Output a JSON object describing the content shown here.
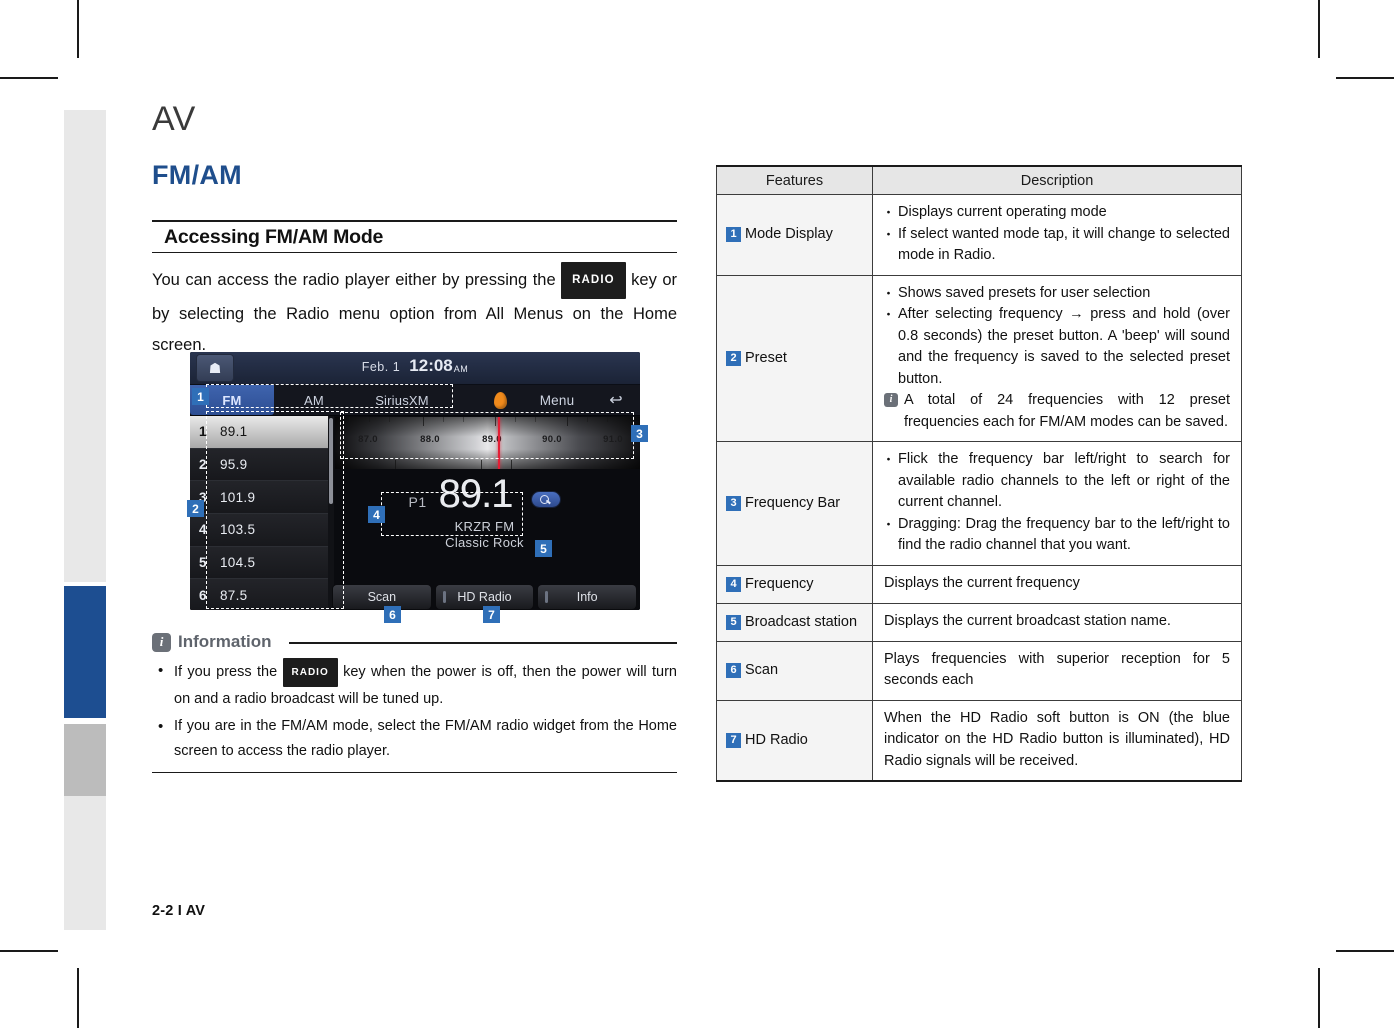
{
  "chapter": "AV",
  "section": "FM/AM",
  "subhead": "Accessing FM/AM Mode",
  "body_part1": "You can access the radio player either by pressing the ",
  "radio_key": "RADIO",
  "body_part2": " key or by selecting the Radio menu option from All Menus on the Home screen.",
  "device": {
    "status": {
      "date": "Feb.  1",
      "time": "12:08",
      "ampm": "AM",
      "home_icon": "home-icon"
    },
    "tabs": {
      "fm": "FM",
      "am": "AM",
      "siriusxm": "SiriusXM",
      "menu": "Menu",
      "back": "↩",
      "sound_icon": "sound-icon"
    },
    "presets": [
      {
        "num": "1",
        "freq": "89.1"
      },
      {
        "num": "2",
        "freq": "95.9"
      },
      {
        "num": "3",
        "freq": "101.9"
      },
      {
        "num": "4",
        "freq": "103.5"
      },
      {
        "num": "5",
        "freq": "104.5"
      },
      {
        "num": "6",
        "freq": "87.5"
      }
    ],
    "freq_bar": {
      "ticks": [
        "87.0",
        "88.0",
        "89.0",
        "90.0",
        "91.0"
      ],
      "needle_at": "89.1"
    },
    "now_playing": {
      "preset_label": "P1",
      "frequency": "89.1",
      "station": "KRZR FM",
      "genre": "Classic Rock",
      "search_icon": "search-icon"
    },
    "soft_buttons": [
      "Scan",
      "HD Radio",
      "Info"
    ],
    "markers": [
      "1",
      "2",
      "3",
      "4",
      "5",
      "6",
      "7"
    ]
  },
  "information": {
    "title": "Information",
    "icon": "info-icon",
    "items_pre": [
      "If you press the ",
      "If you are in the FM/AM mode, select the FM/AM radio widget from the Home screen to access the radio player."
    ],
    "item1_key": "RADIO",
    "item1_post": " key when the power is off, then the power will turn on and a radio broadcast will be tuned up."
  },
  "footer": "2-2 I AV",
  "table": {
    "headers": [
      "Features",
      "Description"
    ],
    "rows": [
      {
        "num": "1",
        "feature": "Mode Display",
        "lines": [
          {
            "type": "dot",
            "text": "Displays current operating mode"
          },
          {
            "type": "dot",
            "text": "If select wanted mode tap, it will change to selected mode in Radio."
          }
        ]
      },
      {
        "num": "2",
        "feature": "Preset",
        "lines": [
          {
            "type": "dot",
            "text": "Shows saved presets for user selection"
          },
          {
            "type": "dot",
            "text": "After selecting frequency → press and hold (over 0.8 seconds) the preset button. A 'beep' will sound and the frequency is saved to the selected preset button."
          },
          {
            "type": "note",
            "text": "A total of 24 frequencies with 12 preset frequencies each for FM/AM modes can be saved."
          }
        ]
      },
      {
        "num": "3",
        "feature": "Frequency Bar",
        "lines": [
          {
            "type": "dot",
            "text": "Flick the frequency bar left/right to search for available radio channels to the left or right of the current channel."
          },
          {
            "type": "dot",
            "text": "Dragging: Drag the frequency bar to the left/right to find the radio channel that you want."
          }
        ]
      },
      {
        "num": "4",
        "feature": "Frequency",
        "lines": [
          {
            "type": "plain",
            "text": "Displays the current frequency"
          }
        ]
      },
      {
        "num": "5",
        "feature": "Broadcast station",
        "lines": [
          {
            "type": "plain",
            "text": "Displays the current broadcast station name."
          }
        ]
      },
      {
        "num": "6",
        "feature": "Scan",
        "lines": [
          {
            "type": "plain",
            "text": "Plays frequencies with superior reception for 5 seconds each"
          }
        ]
      },
      {
        "num": "7",
        "feature": "HD Radio",
        "lines": [
          {
            "type": "plain",
            "text": "When the HD Radio soft button is ON (the blue indicator on the HD Radio button is illuminated), HD Radio signals will be received."
          }
        ]
      }
    ]
  },
  "colors": {
    "accent_blue": "#1f4e8c",
    "marker_blue": "#2f6fb8",
    "tab_blue": "#1d4e91",
    "tab_gray": "#bcbcbc",
    "tab_light": "#e8e8e8"
  }
}
